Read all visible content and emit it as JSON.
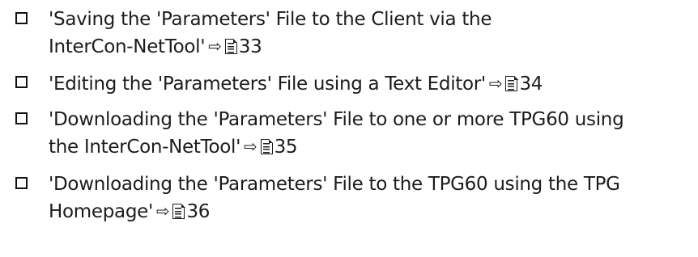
{
  "items": [
    {
      "lines": [
        "'Saving the 'Parameters' File to the Client via the",
        "InterCon-NetTool'"
      ],
      "page": "33"
    },
    {
      "lines": [
        "'Editing the 'Parameters' File using a Text Editor'"
      ],
      "page": "34"
    },
    {
      "lines": [
        "'Downloading the 'Parameters' File to one or more TPG60 using",
        "the InterCon-NetTool'"
      ],
      "page": "35"
    },
    {
      "lines": [
        "'Downloading the 'Parameters' File to the TPG60 using the TPG",
        "Homepage'"
      ],
      "page": "36"
    }
  ]
}
